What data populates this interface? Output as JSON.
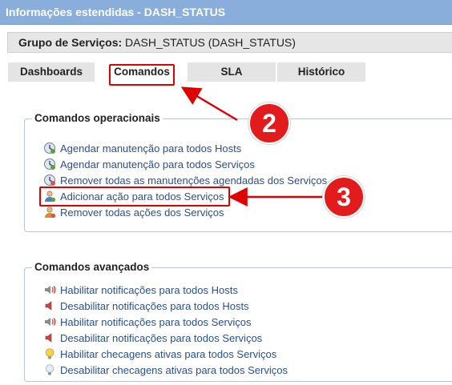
{
  "window": {
    "title": "Informações estendidas - DASH_STATUS"
  },
  "group": {
    "label": "Grupo de Serviços:",
    "value": "DASH_STATUS (DASH_STATUS)"
  },
  "tabs": [
    {
      "label": "Dashboards"
    },
    {
      "label": "Comandos"
    },
    {
      "label": "SLA"
    },
    {
      "label": "Histórico"
    }
  ],
  "operational": {
    "legend": "Comandos operacionais",
    "items": [
      {
        "label": "Agendar manutenção para todos Hosts",
        "icon": "clock-icon"
      },
      {
        "label": "Agendar manutenção para todos Serviços",
        "icon": "clock-icon"
      },
      {
        "label": "Remover todas as manutenções agendadas dos Serviços",
        "icon": "clock-icon"
      },
      {
        "label": "Adicionar ação para todos Serviços",
        "icon": "user-icon"
      },
      {
        "label": "Remover todas ações dos Serviços",
        "icon": "user-icon"
      }
    ]
  },
  "advanced": {
    "legend": "Comandos avançados",
    "items": [
      {
        "label": "Habilitar notificações para todos Hosts",
        "icon": "speaker-on-icon"
      },
      {
        "label": "Desabilitar notificações para todos Hosts",
        "icon": "speaker-off-icon"
      },
      {
        "label": "Habilitar notificações para todos Serviços",
        "icon": "speaker-on-icon"
      },
      {
        "label": "Desabilitar notificações para todos Serviços",
        "icon": "speaker-off-icon"
      },
      {
        "label": "Habilitar checagens ativas para todos Serviços",
        "icon": "bulb-on-icon"
      },
      {
        "label": "Desabilitar checagens ativas para todos Serviços",
        "icon": "bulb-off-icon"
      }
    ]
  },
  "annotations": {
    "step2": "2",
    "step3": "3"
  },
  "colors": {
    "titlebar": "#8aaedb",
    "link": "#2b4f8f",
    "annotation": "#e00000"
  }
}
